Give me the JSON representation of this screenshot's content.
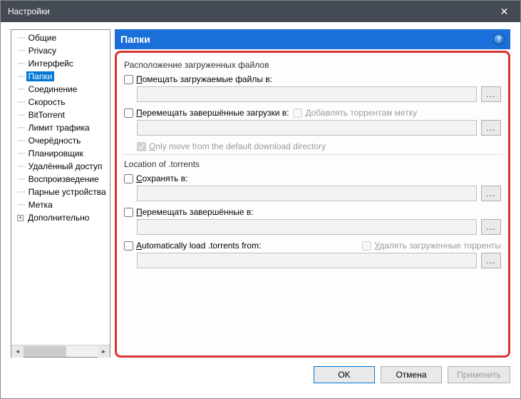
{
  "window": {
    "title": "Настройки",
    "close_label": "✕"
  },
  "tree": {
    "items": [
      {
        "label": "Общие"
      },
      {
        "label": "Privacy"
      },
      {
        "label": "Интерфейс"
      },
      {
        "label": "Папки",
        "selected": true
      },
      {
        "label": "Соединение"
      },
      {
        "label": "Скорость"
      },
      {
        "label": "BitTorrent"
      },
      {
        "label": "Лимит трафика"
      },
      {
        "label": "Очерёдность"
      },
      {
        "label": "Планировщик"
      },
      {
        "label": "Удалённый доступ"
      },
      {
        "label": "Воспроизведение"
      },
      {
        "label": "Парные устройства"
      },
      {
        "label": "Метка"
      },
      {
        "label": "Дополнительно",
        "expandable": true
      }
    ]
  },
  "page": {
    "title": "Папки",
    "help": "?"
  },
  "section1": {
    "title": "Расположение загруженных файлов",
    "put_label_pre": "П",
    "put_label_post": "омещать загружаемые файлы в:",
    "put_value": "",
    "move_label_pre": "П",
    "move_label_post": "еремещать завершённые загрузки в:",
    "move_value": "",
    "append_label_pre": "Д",
    "append_label_post": "обавлять торрентам метку",
    "onlymove_label_pre": "O",
    "onlymove_label_post": "nly move from the default download directory"
  },
  "section2": {
    "title": "Location of .torrents",
    "save_label_pre": "С",
    "save_label_post": "охранять в:",
    "save_value": "",
    "move_label_pre": "П",
    "move_label_post": "еремещать завершённые в:",
    "move_value": "",
    "auto_label_pre": "A",
    "auto_label_post": "utomatically load .torrents from:",
    "auto_value": "",
    "delete_label_pre": "У",
    "delete_label_post": "далять загруженные торренты"
  },
  "buttons": {
    "ok": "OK",
    "cancel": "Отмена",
    "apply": "Применить"
  },
  "browse_label": "..."
}
